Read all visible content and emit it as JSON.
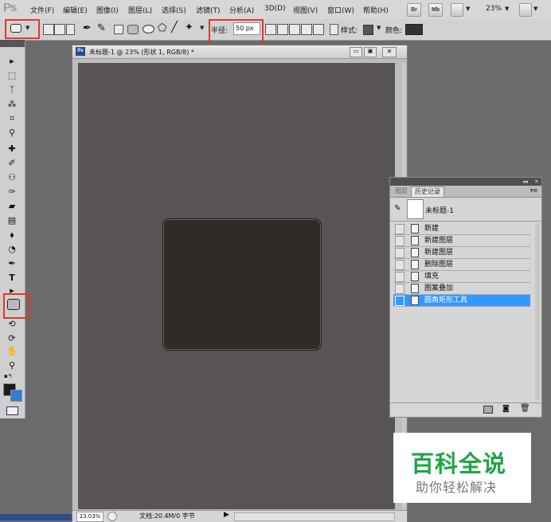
{
  "app": {
    "logo": "Ps"
  },
  "menu": [
    "文件(F)",
    "编辑(E)",
    "图像(I)",
    "图层(L)",
    "选择(S)",
    "滤镜(T)",
    "分析(A)",
    "3D(D)",
    "视图(V)",
    "窗口(W)",
    "帮助(H)"
  ],
  "menu_buttons": {
    "bridge": "Br",
    "mini_bridge": "Mb",
    "zoom": "23%"
  },
  "options": {
    "radius_label": "半径:",
    "radius_value": "50 px",
    "style_label": "样式:",
    "color_label": "颜色:",
    "color_swatch": "#333333"
  },
  "document": {
    "icon": "Ps",
    "title": "未标题-1 @ 23% (形状 1, RGB/8) *",
    "zoom": "23.03%",
    "doc_info": "文档:20.4M/0 字节",
    "canvas_color": "#575453",
    "shape_color": "#2f2b29"
  },
  "panel": {
    "tabs": [
      "图层",
      "历史记录"
    ],
    "snapshot_label": "未标题-1",
    "history": [
      "新建",
      "新建图层",
      "新建图层",
      "删除图层",
      "填充",
      "图案叠加",
      "圆角矩形工具"
    ],
    "selected_index": 6
  },
  "watermark": {
    "title": "百科全说",
    "subtitle": "助你轻松解决"
  },
  "colors": {
    "highlight_red": "#e0392b",
    "selection_blue": "#3398ff",
    "watermark_green": "#1ea547"
  }
}
